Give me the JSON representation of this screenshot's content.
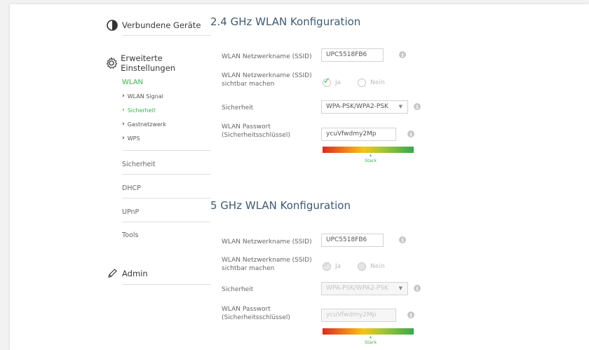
{
  "sidebar": {
    "connected_devices": "Verbundene Geräte",
    "advanced_settings": "Erweiterte Einstellungen",
    "wlan": "WLAN",
    "wlan_items": [
      {
        "label": "WLAN Signal"
      },
      {
        "label": "Sicherheit"
      },
      {
        "label": "Gastnetzwerk"
      },
      {
        "label": "WPS"
      }
    ],
    "security": "Sicherheit",
    "dhcp": "DHCP",
    "upnp": "UPnP",
    "tools": "Tools",
    "admin": "Admin"
  },
  "band24": {
    "title": "2.4 GHz WLAN Konfiguration",
    "ssid_label": "WLAN Netzwerkname (SSID)",
    "ssid_value": "UPC5518FB6",
    "visible_label_1": "WLAN Netzwerkname (SSID)",
    "visible_label_2": "sichtbar machen",
    "yes": "Ja",
    "no": "Nein",
    "security_label": "Sicherheit",
    "security_value": "WPA-PSK/WPA2-PSK",
    "password_label_1": "WLAN Passwort",
    "password_label_2": "(Sicherheitsschlüssel)",
    "password_value": "ycuVfwdmy2Mp",
    "strength": "Stark"
  },
  "band5": {
    "title": "5 GHz WLAN Konfiguration",
    "ssid_label": "WLAN Netzwerkname (SSID)",
    "ssid_value": "UPC5518FB6",
    "visible_label_1": "WLAN Netzwerkname (SSID)",
    "visible_label_2": "sichtbar machen",
    "yes": "Ja",
    "no": "Nein",
    "security_label": "Sicherheit",
    "security_value": "WPA-PSK/WPA2-PSK",
    "password_label_1": "WLAN Passwort",
    "password_label_2": "(Sicherheitsschlüssel)",
    "password_value": "ycuVfwdmy2Mp",
    "strength": "Stark"
  },
  "colors": {
    "accent": "#3ab54a",
    "title": "#3f5a73"
  },
  "icons": {
    "connected_devices": "devices-toggle-icon",
    "advanced_settings": "gear-icon",
    "admin": "pencil-icon",
    "info": "info-icon",
    "select": "chevron-down-icon"
  }
}
